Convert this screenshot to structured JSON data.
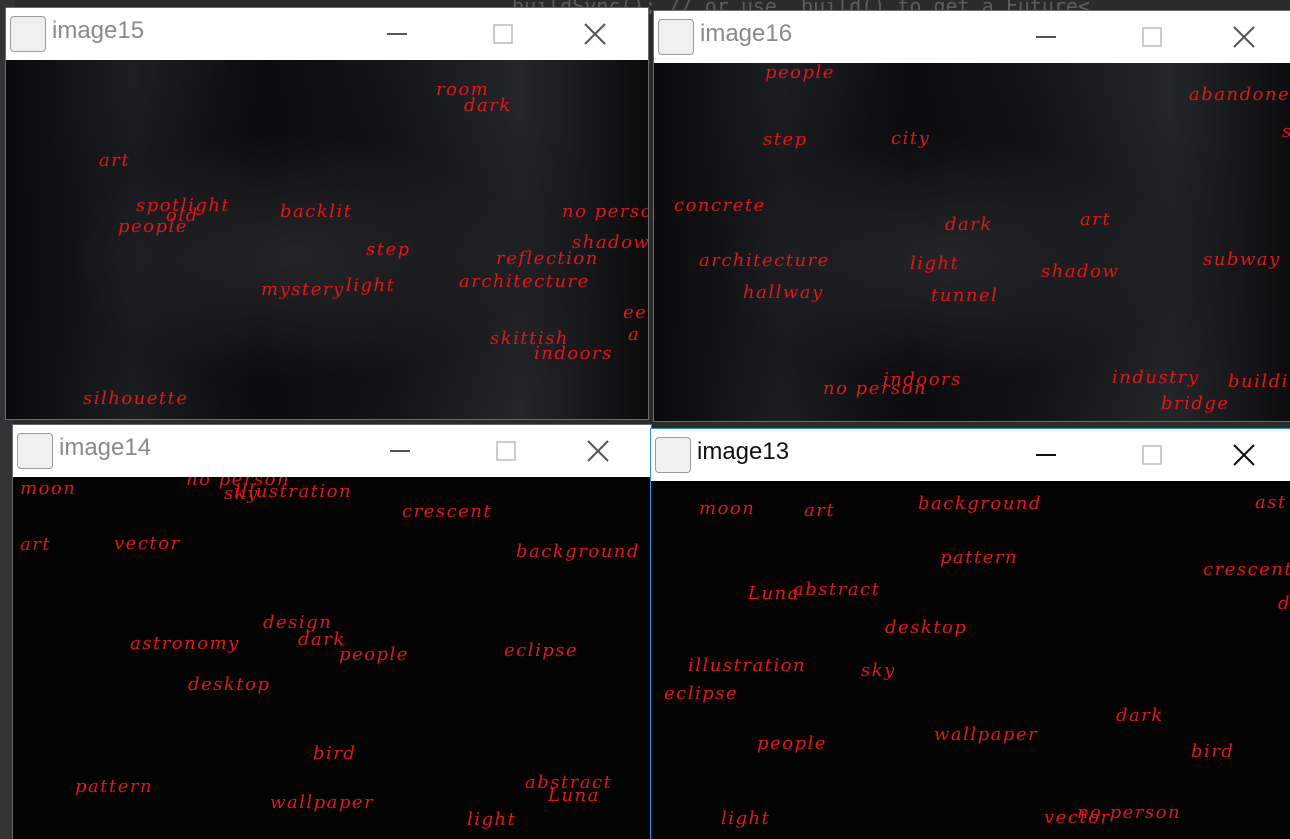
{
  "editor": {
    "code": ".buildSync(); // or use .build() to get a Future<"
  },
  "windows": {
    "image15": {
      "title": "image15",
      "tags": [
        "room",
        "dark",
        "art",
        "spotlight",
        "old",
        "people",
        "backlit",
        "no person",
        "shadow",
        "step",
        "reflection",
        "mystery",
        "light",
        "architecture",
        "ee",
        "a",
        "skittish",
        "indoors",
        "silhouette"
      ]
    },
    "image16": {
      "title": "image16",
      "tags": [
        "people",
        "abandoned",
        "s",
        "step",
        "city",
        "concrete",
        "dark",
        "art",
        "architecture",
        "light",
        "subway",
        "hallway",
        "tunnel",
        "shadow",
        "indoors",
        "no person",
        "industry",
        "building",
        "bridge"
      ]
    },
    "image14": {
      "title": "image14",
      "tags": [
        "moon",
        "no person",
        "sky",
        "illustration",
        "crescent",
        "art",
        "vector",
        "background",
        "design",
        "astronomy",
        "dark",
        "people",
        "eclipse",
        "desktop",
        "bird",
        "pattern",
        "abstract",
        "wallpaper",
        "Luna",
        "light"
      ]
    },
    "image13": {
      "title": "image13",
      "tags": [
        "moon",
        "art",
        "background",
        "ast",
        "pattern",
        "crescent",
        "de",
        "Luna",
        "abstract",
        "desktop",
        "illustration",
        "sky",
        "eclipse",
        "dark",
        "wallpaper",
        "people",
        "bird",
        "light",
        "vector",
        "no person"
      ]
    }
  },
  "icons": {
    "app": "java-cup-icon",
    "minimize": "minimize-icon",
    "maximize": "maximize-icon",
    "close": "close-icon"
  },
  "colors": {
    "tag": "#e0171b",
    "focus_border": "#3c8bd6"
  }
}
